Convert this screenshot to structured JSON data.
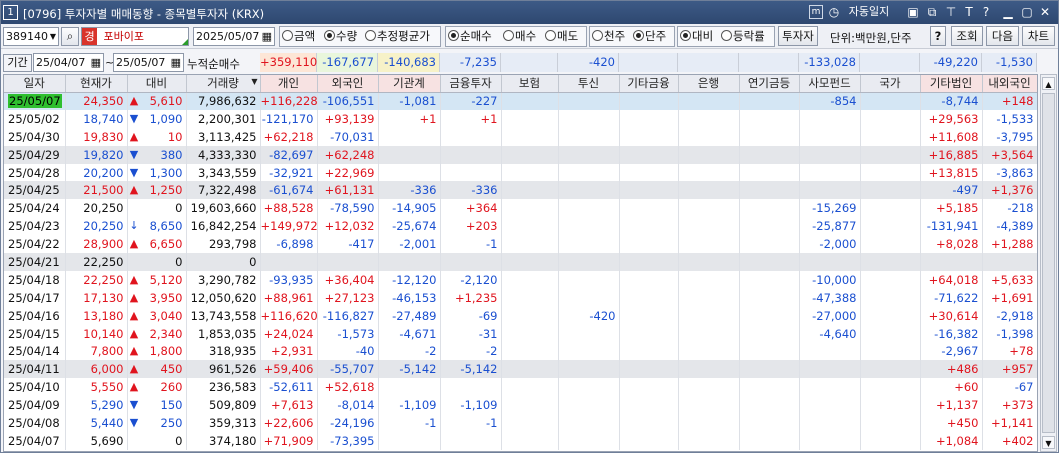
{
  "window": {
    "number": "1",
    "title": "[0796] 투자자별 매매동향 - 종목별투자자 (KRX)",
    "auto_window": "자동일지"
  },
  "toolbar": {
    "code": "389140",
    "search_icon": "search-icon",
    "market_badge": "경",
    "name": "포바이포",
    "date": "2025/05/07",
    "radios1": [
      {
        "label": "금액",
        "on": false
      },
      {
        "label": "수량",
        "on": true
      },
      {
        "label": "추정평균가",
        "on": false
      }
    ],
    "radios2": [
      {
        "label": "순매수",
        "on": true
      },
      {
        "label": "매수",
        "on": false
      },
      {
        "label": "매도",
        "on": false
      }
    ],
    "radios3": [
      {
        "label": "천주",
        "on": false
      },
      {
        "label": "단주",
        "on": true
      }
    ],
    "radios4": [
      {
        "label": "대비",
        "on": true
      },
      {
        "label": "등락률",
        "on": false
      }
    ],
    "investor_btn": "투자자",
    "unit": "단위:백만원,단주",
    "help": "?",
    "query": "조회",
    "next": "다음",
    "chart": "차트"
  },
  "period": {
    "label": "기간",
    "from": "25/04/07",
    "to": "25/05/07",
    "tilde": "~",
    "cum_label": "누적순매수",
    "sums": [
      "+359,110",
      "-167,677",
      "-140,683",
      "-7,235",
      "",
      "-420",
      "",
      "",
      "",
      "-133,028",
      "",
      "-49,220",
      "-1,530"
    ]
  },
  "columns": [
    "일자",
    "현재가",
    "대비",
    "거래량",
    "개인",
    "외국인",
    "기관계",
    "금융투자",
    "보험",
    "투신",
    "기타금융",
    "은행",
    "연기금등",
    "사모펀드",
    "국가",
    "기타법인",
    "내외국인"
  ],
  "rows": [
    [
      "25/05/07",
      "24,350",
      "up",
      "5,610",
      "7,986,632",
      "+116,228",
      "-106,551",
      "-1,081",
      "-227",
      "",
      "",
      "",
      "",
      "",
      "-854",
      "",
      "-8,744",
      "+148"
    ],
    [
      "25/05/02",
      "18,740",
      "dn",
      "1,090",
      "2,200,301",
      "-121,170",
      "+93,139",
      "+1",
      "+1",
      "",
      "",
      "",
      "",
      "",
      "",
      "",
      "+29,563",
      "-1,533"
    ],
    [
      "25/04/30",
      "19,830",
      "up",
      "10",
      "3,113,425",
      "+62,218",
      "-70,031",
      "",
      "",
      "",
      "",
      "",
      "",
      "",
      "",
      "",
      "+11,608",
      "-3,795"
    ],
    [
      "25/04/29",
      "19,820",
      "dn",
      "380",
      "4,333,330",
      "-82,697",
      "+62,248",
      "",
      "",
      "",
      "",
      "",
      "",
      "",
      "",
      "",
      "+16,885",
      "+3,564"
    ],
    [
      "25/04/28",
      "20,200",
      "dn",
      "1,300",
      "3,343,559",
      "-32,921",
      "+22,969",
      "",
      "",
      "",
      "",
      "",
      "",
      "",
      "",
      "",
      "+13,815",
      "-3,863"
    ],
    [
      "25/04/25",
      "21,500",
      "up",
      "1,250",
      "7,322,498",
      "-61,674",
      "+61,131",
      "-336",
      "-336",
      "",
      "",
      "",
      "",
      "",
      "",
      "",
      "-497",
      "+1,376"
    ],
    [
      "25/04/24",
      "20,250",
      "",
      "0",
      "19,603,660",
      "+88,528",
      "-78,590",
      "-14,905",
      "+364",
      "",
      "",
      "",
      "",
      "",
      "-15,269",
      "",
      "+5,185",
      "-218"
    ],
    [
      "25/04/23",
      "20,250",
      "dnb",
      "8,650",
      "16,842,254",
      "+149,972",
      "+12,032",
      "-25,674",
      "+203",
      "",
      "",
      "",
      "",
      "",
      "-25,877",
      "",
      "-131,941",
      "-4,389"
    ],
    [
      "25/04/22",
      "28,900",
      "up",
      "6,650",
      "293,798",
      "-6,898",
      "-417",
      "-2,001",
      "-1",
      "",
      "",
      "",
      "",
      "",
      "-2,000",
      "",
      "+8,028",
      "+1,288"
    ],
    [
      "25/04/21",
      "22,250",
      "",
      "0",
      "0",
      "",
      "",
      "",
      "",
      "",
      "",
      "",
      "",
      "",
      "",
      "",
      "",
      ""
    ],
    [
      "25/04/18",
      "22,250",
      "up",
      "5,120",
      "3,290,782",
      "-93,935",
      "+36,404",
      "-12,120",
      "-2,120",
      "",
      "",
      "",
      "",
      "",
      "-10,000",
      "",
      "+64,018",
      "+5,633"
    ],
    [
      "25/04/17",
      "17,130",
      "up",
      "3,950",
      "12,050,620",
      "+88,961",
      "+27,123",
      "-46,153",
      "+1,235",
      "",
      "",
      "",
      "",
      "",
      "-47,388",
      "",
      "-71,622",
      "+1,691"
    ],
    [
      "25/04/16",
      "13,180",
      "up",
      "3,040",
      "13,743,558",
      "+116,620",
      "-116,827",
      "-27,489",
      "-69",
      "",
      "-420",
      "",
      "",
      "",
      "-27,000",
      "",
      "+30,614",
      "-2,918"
    ],
    [
      "25/04/15",
      "10,140",
      "up",
      "2,340",
      "1,853,035",
      "+24,024",
      "-1,573",
      "-4,671",
      "-31",
      "",
      "",
      "",
      "",
      "",
      "-4,640",
      "",
      "-16,382",
      "-1,398"
    ],
    [
      "25/04/14",
      "7,800",
      "up",
      "1,800",
      "318,935",
      "+2,931",
      "-40",
      "-2",
      "-2",
      "",
      "",
      "",
      "",
      "",
      "",
      "",
      "-2,967",
      "+78"
    ],
    [
      "25/04/11",
      "6,000",
      "up",
      "450",
      "961,526",
      "+59,406",
      "-55,707",
      "-5,142",
      "-5,142",
      "",
      "",
      "",
      "",
      "",
      "",
      "",
      "+486",
      "+957"
    ],
    [
      "25/04/10",
      "5,550",
      "up",
      "260",
      "236,583",
      "-52,611",
      "+52,618",
      "",
      "",
      "",
      "",
      "",
      "",
      "",
      "",
      "",
      "+60",
      "-67"
    ],
    [
      "25/04/09",
      "5,290",
      "dn",
      "150",
      "509,809",
      "+7,613",
      "-8,014",
      "-1,109",
      "-1,109",
      "",
      "",
      "",
      "",
      "",
      "",
      "",
      "+1,137",
      "+373"
    ],
    [
      "25/04/08",
      "5,440",
      "dn",
      "250",
      "359,313",
      "+22,606",
      "-24,196",
      "-1",
      "-1",
      "",
      "",
      "",
      "",
      "",
      "",
      "",
      "+450",
      "+1,141"
    ],
    [
      "25/04/07",
      "5,690",
      "",
      "0",
      "374,180",
      "+71,909",
      "-73,395",
      "",
      "",
      "",
      "",
      "",
      "",
      "",
      "",
      "",
      "+1,084",
      "+402"
    ]
  ],
  "colors": {
    "up": "#e0141e",
    "down": "#1a4fd0",
    "title": "#2e4870",
    "highlight_row": "#d4e6f4",
    "selected_date": "#2fbf2f"
  }
}
